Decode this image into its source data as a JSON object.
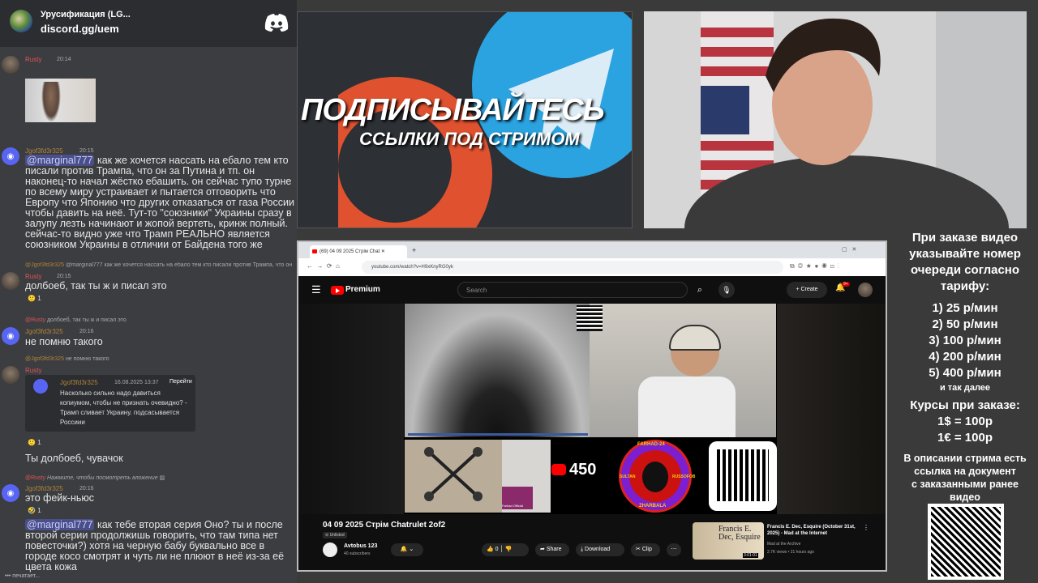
{
  "discord": {
    "server_name": "Урусификация (LG...",
    "invite": "discord.gg/uem",
    "messages": [
      {
        "user": "Rusty",
        "time": "20:14"
      },
      {
        "user": "Jgof3fd3r325",
        "time": "20:15",
        "mention": "@marginal777",
        "text": "как же хочется нассать на ебало тем кто писали против Трампа, что он за Путина и тп. он наконец-то начал жёстко ебашить. он сейчас тупо турне по всему миру устраивает и пытается отговорить что Европу что Японию что других отказаться от газа России чтобы давить на неё. Тут-то \"союзники\" Украины сразу в залупу лезть начинают и жопой вертеть, кринж полный. сейчас-то видно уже что Трамп РЕАЛЬНО является союзником Украины в отличии от Байдена того же"
      },
      {
        "reply": "@marginal777 как же хочется нассать на ебало тем кто писали против Трампа, что он",
        "reply_user": "@Jgof3fd3r325",
        "user": "Rusty",
        "time": "20:15",
        "text": "долбоеб, так ты ж и писал это",
        "reactions": "1"
      },
      {
        "reply": "долбоеб, так ты ж и писал это",
        "reply_user": "@Rusty",
        "user": "Jgof3fd3r325",
        "time": "20:16",
        "text": "не помню такого"
      },
      {
        "reply": "не помню такого",
        "reply_user": "@Jgof3fd3r325",
        "user": "Rusty",
        "time": "",
        "embed": {
          "author": "Jgof3fd3r325",
          "date": "16.08.2025 13:37",
          "action": "Перейти",
          "text": "Насколько сильно надо давиться копиумом, чтобы не признать очевидно? - Трамп сливает Украину. подсасывается Россиии"
        },
        "reactions": "1",
        "text": "Ты долбоеб, чувачок"
      },
      {
        "reply": "Нажмите, чтобы посмотреть вложение",
        "reply_user": "@Rusty",
        "user": "Jgof3fd3r325",
        "time": "20:16",
        "text": "это фейк-ньюс",
        "reactions": "1"
      },
      {
        "mention": "@marginal777",
        "text": "как тебе вторая серия Оно? ты и после второй серии продолжишь говорить, что там типа нет повесточки?) хотя на черную бабу буквально все в городе косо смотрят и чуть ли не плюют в неё из-за её цвета кожа"
      }
    ],
    "typing": "печатает..."
  },
  "promo": {
    "headline": "ПОДПИСЫВАЙТЕСЬ",
    "subline": "ССЫЛКИ ПОД СТРИМОМ"
  },
  "browser": {
    "tab_title": "(69) 04 09 2025 Стрім Chat",
    "url": "youtube.com/watch?v=H9xKnyRG0yk",
    "yt_brand": "Premium",
    "search_placeholder": "Search",
    "create_label": "Create",
    "notif_badge": "9+",
    "viewer_count": "450",
    "badge_top": "FARHAD-24",
    "badge_left": "SULTAN",
    "badge_right": "RUSSOFOB",
    "badge_bottom": "ZHARBALA",
    "cam_label": "Farhad Official",
    "video_title": "04 09 2025 Стрім Chatrulet 2of2",
    "unlisted": "Unlisted",
    "channel": "Avtobus 123",
    "subscribers": "40 subscribers",
    "likes": "0",
    "share": "Share",
    "download": "Download",
    "clip": "Clip",
    "rec_title": "Francis E. Dec, Esquire (October 31st, 2025) - Mad at the Internet",
    "rec_channel": "Mad at the Archive",
    "rec_meta": "2.7K views • 21 hours ago",
    "rec_thumb_text": "Francis E. Dec, Esquire",
    "rec_duration": "3:01:01"
  },
  "info": {
    "lines": [
      "При заказе видео",
      "указывайте номер",
      "очереди согласно",
      "тарифу:"
    ],
    "rates": [
      "1) 25 р/мин",
      "2) 50 р/мин",
      "3) 100 р/мин",
      "4) 200 р/мин",
      "5) 400 р/мин"
    ],
    "etc": "и так далее",
    "courses_title": "Курсы при заказе:",
    "usd": "1$ = 100р",
    "eur": "1€ = 100р",
    "desc": [
      "В описании стрима есть",
      "ссылка на документ",
      "с заказанными ранее",
      "видео"
    ]
  }
}
